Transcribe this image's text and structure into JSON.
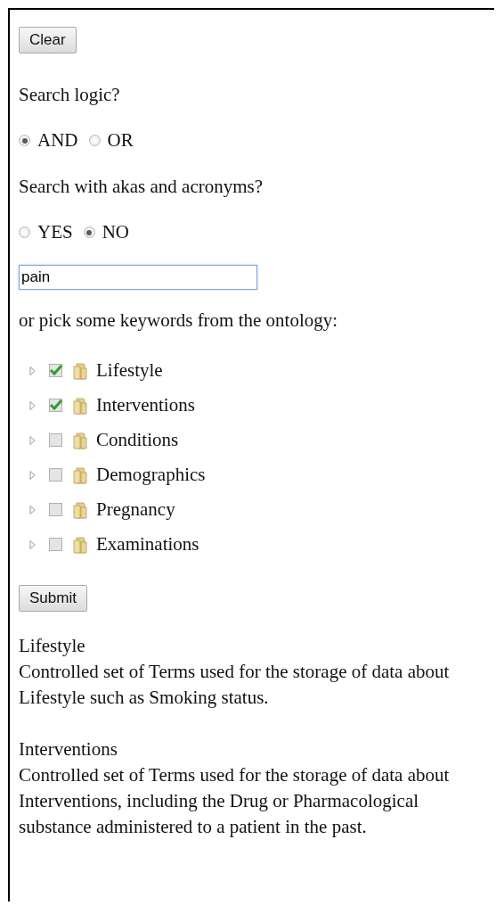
{
  "clear_button": "Clear",
  "search_logic": {
    "question": "Search logic?",
    "options": [
      {
        "label": "AND",
        "selected": true
      },
      {
        "label": "OR",
        "selected": false
      }
    ]
  },
  "akas": {
    "question": "Search with akas and acronyms?",
    "options": [
      {
        "label": "YES",
        "selected": false
      },
      {
        "label": "NO",
        "selected": true
      }
    ]
  },
  "search_field": {
    "value": "pain"
  },
  "ontology_prompt": "or pick some keywords from the ontology:",
  "tree": [
    {
      "label": "Lifestyle",
      "checked": true,
      "expanded": false
    },
    {
      "label": "Interventions",
      "checked": true,
      "expanded": false
    },
    {
      "label": "Conditions",
      "checked": false,
      "expanded": false
    },
    {
      "label": "Demographics",
      "checked": false,
      "expanded": false
    },
    {
      "label": "Pregnancy",
      "checked": false,
      "expanded": false
    },
    {
      "label": "Examinations",
      "checked": false,
      "expanded": false
    }
  ],
  "submit_button": "Submit",
  "descriptions": [
    {
      "title": "Lifestyle",
      "text": "Controlled set of Terms used for the storage of data about Lifestyle such as Smoking status."
    },
    {
      "title": "Interventions",
      "text": "Controlled set of Terms used for the storage of data about Interventions, including the Drug or Pharmacological substance administered to a patient in the past."
    }
  ]
}
